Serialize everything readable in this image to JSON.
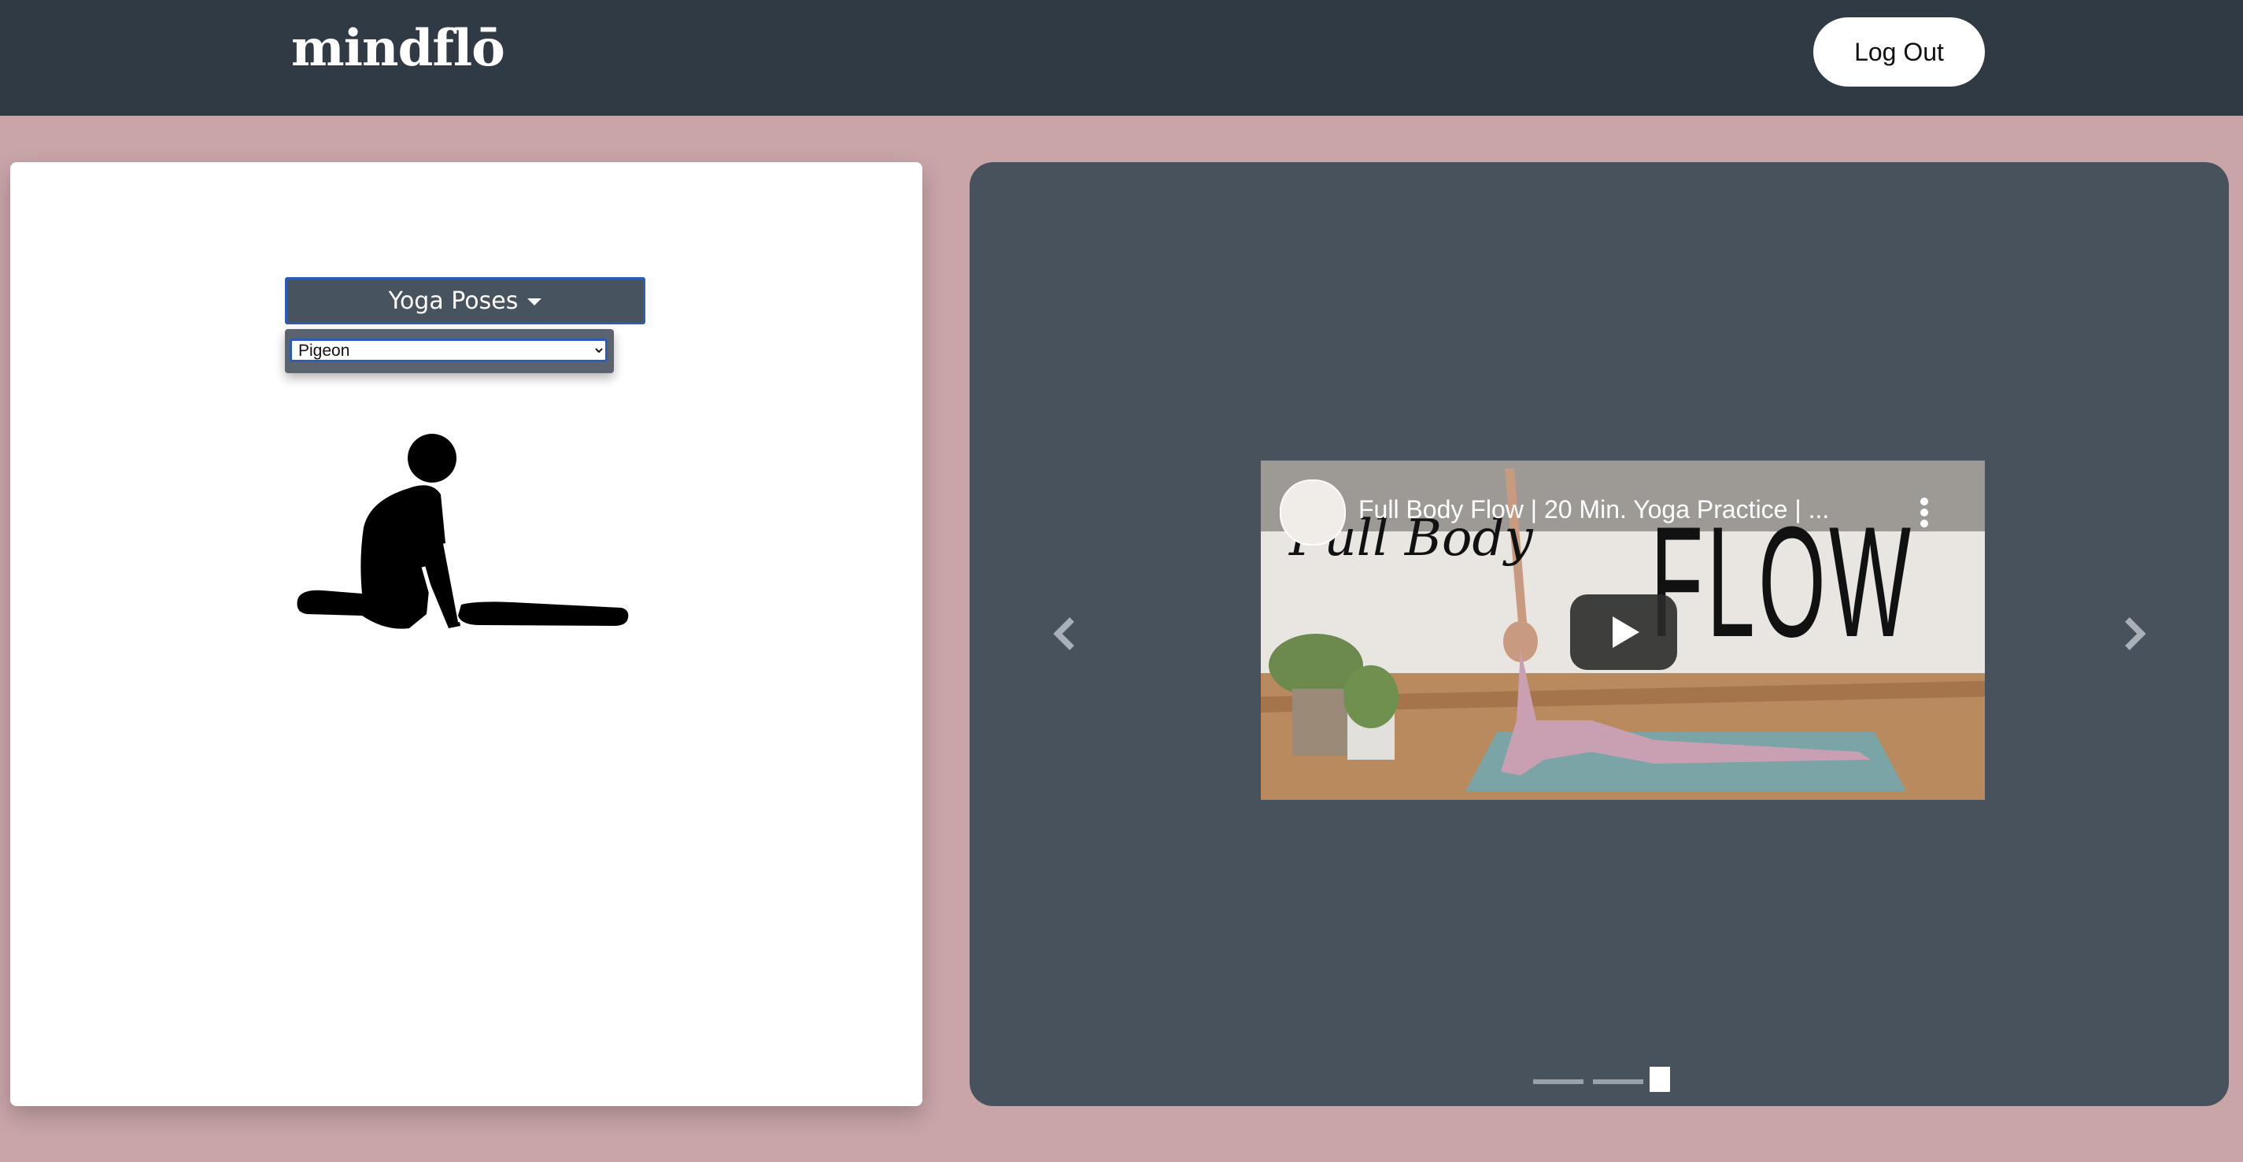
{
  "navbar": {
    "brand": "mindflō",
    "logout_label": "Log Out"
  },
  "poses": {
    "dropdown_label": "Yoga Poses",
    "selected_pose": "Pigeon",
    "options": [
      "Pigeon"
    ]
  },
  "video": {
    "title": "Full Body Flow | 20 Min. Yoga Practice | ...",
    "thumb_text_script": "Full Body",
    "thumb_text_big": "FLOW"
  },
  "carousel": {
    "indicator_count": 3,
    "active_index": 2
  },
  "colors": {
    "page_bg": "#c9a5a8",
    "navbar_bg": "#2f3a45",
    "right_card_bg": "#47525d",
    "dropdown_bg": "#47535f",
    "accent_blue": "#2c5cb8"
  }
}
